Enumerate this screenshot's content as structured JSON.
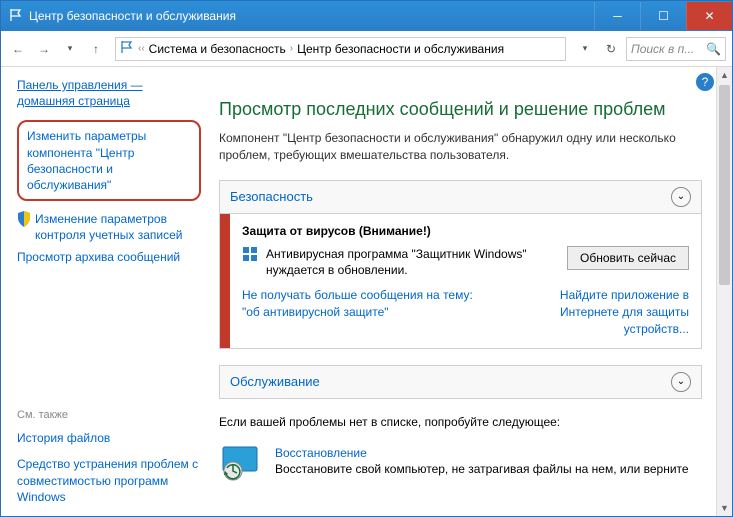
{
  "window": {
    "title": "Центр безопасности и обслуживания"
  },
  "breadcrumb": {
    "root": "Система и безопасность",
    "current": "Центр безопасности и обслуживания"
  },
  "search": {
    "placeholder": "Поиск в п..."
  },
  "sidebar": {
    "home_label": "Панель управления — домашняя страница",
    "change_settings": "Изменить параметры компонента \"Центр безопасности и обслуживания\"",
    "uac": "Изменение параметров контроля учетных записей",
    "archive": "Просмотр архива сообщений",
    "see_also": "См. также",
    "file_history": "История файлов",
    "compat": "Средство устранения проблем с совместимостью программ Windows"
  },
  "main": {
    "heading": "Просмотр последних сообщений и решение проблем",
    "intro": "Компонент \"Центр безопасности и обслуживания\" обнаружил одну или несколько проблем, требующих вмешательства пользователя.",
    "security": {
      "label": "Безопасность",
      "alert_title": "Защита от вирусов  (Внимание!)",
      "alert_body": "Антивирусная программа \"Защитник Windows\" нуждается в обновлении.",
      "update_btn": "Обновить сейчас",
      "mute_link_1": "Не получать больше сообщения на тему:",
      "mute_link_2": "\"об антивирусной защите\"",
      "find_app": "Найдите приложение в Интернете для защиты устройств..."
    },
    "maintenance": {
      "label": "Обслуживание"
    },
    "notfound": "Если вашей проблемы нет в списке, попробуйте следующее:",
    "recovery": {
      "title": "Восстановление",
      "body": "Восстановите свой компьютер, не затрагивая файлы на нем, или верните"
    }
  }
}
